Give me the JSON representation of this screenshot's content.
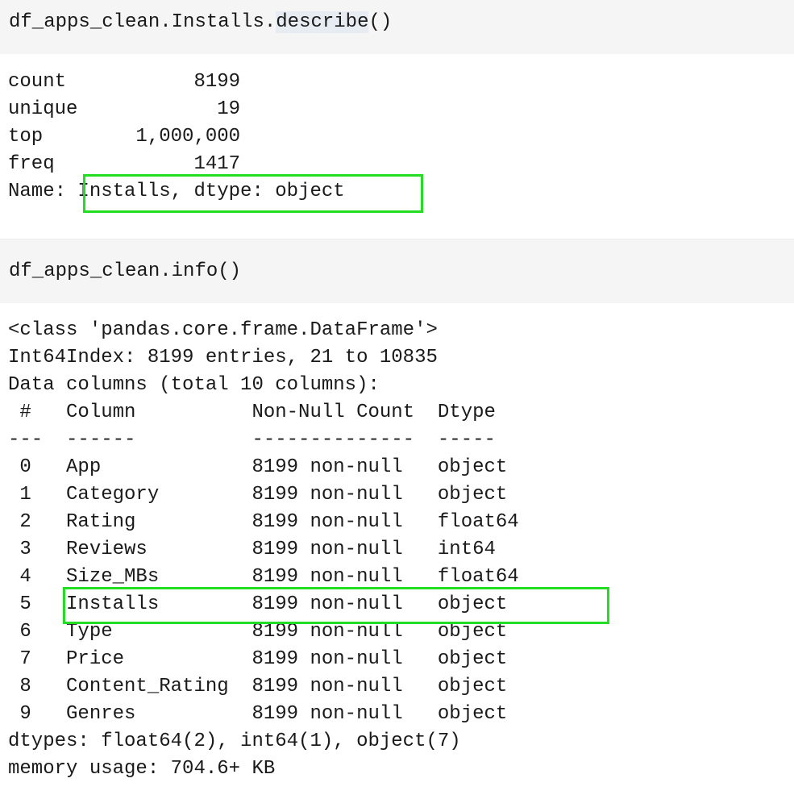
{
  "cells": [
    {
      "input": {
        "object": "df_apps_clean.Installs.",
        "method": "describe",
        "suffix": "()"
      },
      "output_lines": [
        "count           8199",
        "unique            19",
        "top        1,000,000",
        "freq            1417",
        "Name: Installs, dtype: object"
      ]
    },
    {
      "input": {
        "object": "df_apps_clean.info()"
      },
      "output_lines": [
        "<class 'pandas.core.frame.DataFrame'>",
        "Int64Index: 8199 entries, 21 to 10835",
        "Data columns (total 10 columns):",
        " #   Column          Non-Null Count  Dtype  ",
        "---  ------          --------------  -----  ",
        " 0   App             8199 non-null   object ",
        " 1   Category        8199 non-null   object ",
        " 2   Rating          8199 non-null   float64",
        " 3   Reviews         8199 non-null   int64  ",
        " 4   Size_MBs        8199 non-null   float64",
        " 5   Installs        8199 non-null   object ",
        " 6   Type            8199 non-null   object ",
        " 7   Price           8199 non-null   object ",
        " 8   Content_Rating  8199 non-null   object ",
        " 9   Genres          8199 non-null   object ",
        "dtypes: float64(2), int64(1), object(7)",
        "memory usage: 704.6+ KB"
      ]
    }
  ],
  "highlight_color": "#22dd22"
}
